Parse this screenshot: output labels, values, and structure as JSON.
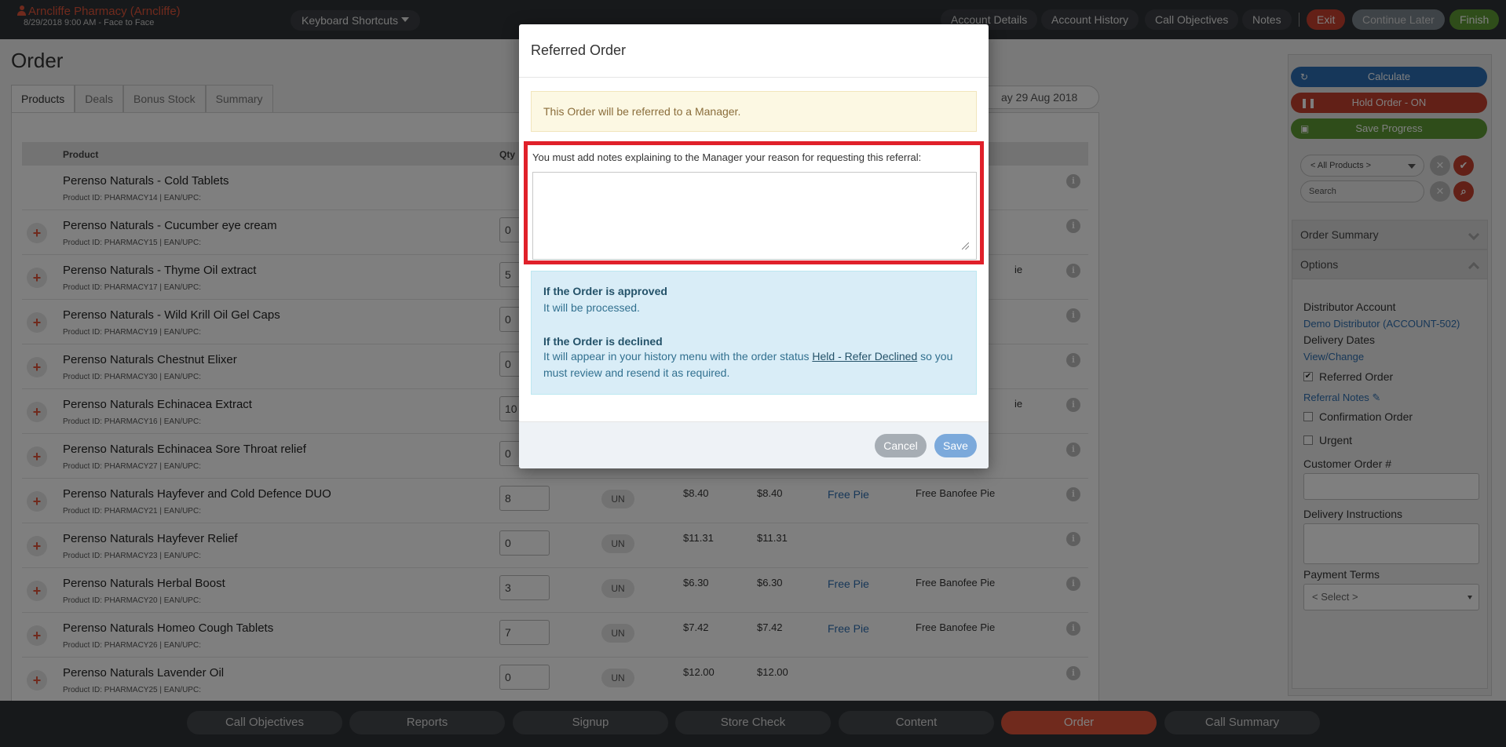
{
  "topbar": {
    "account_name": "Arncliffe Pharmacy (Arncliffe)",
    "visit_info": "8/29/2018 9:00 AM - Face to Face",
    "keyboard_shortcuts": "Keyboard Shortcuts",
    "buttons": {
      "account_details": "Account Details",
      "account_history": "Account History",
      "call_objectives": "Call Objectives",
      "notes": "Notes",
      "exit": "Exit",
      "continue_later": "Continue Later",
      "finish": "Finish"
    }
  },
  "main": {
    "title": "Order",
    "tabs": [
      "Products",
      "Deals",
      "Bonus Stock",
      "Summary"
    ],
    "date_value": "ay 29 Aug 2018",
    "columns": {
      "product": "Product",
      "qty": "Qty"
    },
    "rows": [
      {
        "name": "Perenso Naturals - Cold Tablets",
        "id": "Product ID: PHARMACY14 | EAN/UPC:",
        "qty": "",
        "unit": "",
        "price1": "",
        "price2": "",
        "deal": "",
        "deal_desc": ""
      },
      {
        "name": "Perenso Naturals - Cucumber eye cream",
        "id": "Product ID: PHARMACY15 | EAN/UPC:",
        "qty": "0",
        "unit": "",
        "price1": "",
        "price2": "",
        "deal": "",
        "deal_desc": ""
      },
      {
        "name": "Perenso Naturals - Thyme Oil extract",
        "id": "Product ID: PHARMACY17 | EAN/UPC:",
        "qty": "5",
        "unit": "",
        "price1": "",
        "price2": "",
        "deal": "",
        "deal_desc": "ie"
      },
      {
        "name": "Perenso Naturals - Wild Krill Oil Gel Caps",
        "id": "Product ID: PHARMACY19 | EAN/UPC:",
        "qty": "0",
        "unit": "",
        "price1": "",
        "price2": "",
        "deal": "",
        "deal_desc": ""
      },
      {
        "name": "Perenso Naturals Chestnut Elixer",
        "id": "Product ID: PHARMACY30 | EAN/UPC:",
        "qty": "0",
        "unit": "",
        "price1": "",
        "price2": "",
        "deal": "",
        "deal_desc": ""
      },
      {
        "name": "Perenso Naturals Echinacea Extract",
        "id": "Product ID: PHARMACY16 | EAN/UPC:",
        "qty": "10",
        "unit": "",
        "price1": "",
        "price2": "",
        "deal": "",
        "deal_desc": "ie"
      },
      {
        "name": "Perenso Naturals Echinacea Sore Throat relief",
        "id": "Product ID: PHARMACY27 | EAN/UPC:",
        "qty": "0",
        "unit": "",
        "price1": "",
        "price2": "",
        "deal": "",
        "deal_desc": ""
      },
      {
        "name": "Perenso Naturals Hayfever and Cold Defence DUO",
        "id": "Product ID: PHARMACY21 | EAN/UPC:",
        "qty": "8",
        "unit": "UN",
        "price1": "$8.40",
        "price2": "$8.40",
        "deal": "Free Pie",
        "deal_desc": "Free Banofee Pie"
      },
      {
        "name": "Perenso Naturals Hayfever Relief",
        "id": "Product ID: PHARMACY23 | EAN/UPC:",
        "qty": "0",
        "unit": "UN",
        "price1": "$11.31",
        "price2": "$11.31",
        "deal": "",
        "deal_desc": ""
      },
      {
        "name": "Perenso Naturals Herbal Boost",
        "id": "Product ID: PHARMACY20 | EAN/UPC:",
        "qty": "3",
        "unit": "UN",
        "price1": "$6.30",
        "price2": "$6.30",
        "deal": "Free Pie",
        "deal_desc": "Free Banofee Pie"
      },
      {
        "name": "Perenso Naturals Homeo Cough Tablets",
        "id": "Product ID: PHARMACY26 | EAN/UPC:",
        "qty": "7",
        "unit": "UN",
        "price1": "$7.42",
        "price2": "$7.42",
        "deal": "Free Pie",
        "deal_desc": "Free Banofee Pie"
      },
      {
        "name": "Perenso Naturals Lavender Oil",
        "id": "Product ID: PHARMACY25 | EAN/UPC:",
        "qty": "0",
        "unit": "UN",
        "price1": "$12.00",
        "price2": "$12.00",
        "deal": "",
        "deal_desc": ""
      }
    ]
  },
  "sidebar": {
    "calculate": "Calculate",
    "hold_order": "Hold Order - ON",
    "save_progress": "Save Progress",
    "product_filter": "< All Products >",
    "search_placeholder": "Search",
    "order_summary": "Order Summary",
    "options": "Options",
    "distributor_account_label": "Distributor Account",
    "distributor_account_value": "Demo Distributor (ACCOUNT-502)",
    "delivery_dates_label": "Delivery Dates",
    "view_change": "View/Change",
    "referred_order": "Referred Order",
    "referral_notes": "Referral Notes",
    "confirmation_order": "Confirmation Order",
    "urgent": "Urgent",
    "customer_order_label": "Customer Order #",
    "delivery_instructions_label": "Delivery Instructions",
    "payment_terms_label": "Payment Terms",
    "payment_terms_value": "< Select >"
  },
  "bottom_nav": [
    "Call Objectives",
    "Reports",
    "Signup",
    "Store Check",
    "Content",
    "Order",
    "Call Summary"
  ],
  "modal": {
    "title": "Referred Order",
    "warning": "This Order will be referred to a Manager.",
    "notes_label": "You must add notes explaining to the Manager your reason for requesting this referral:",
    "notes_value": "",
    "approved_heading": "If the Order is approved",
    "approved_text": "It will be processed.",
    "declined_heading": "If the Order is declined",
    "declined_text_before": "It will appear in your history menu with the order status ",
    "declined_status": "Held - Refer Declined",
    "declined_text_after": " so you must review and resend it as required.",
    "cancel": "Cancel",
    "save": "Save"
  }
}
